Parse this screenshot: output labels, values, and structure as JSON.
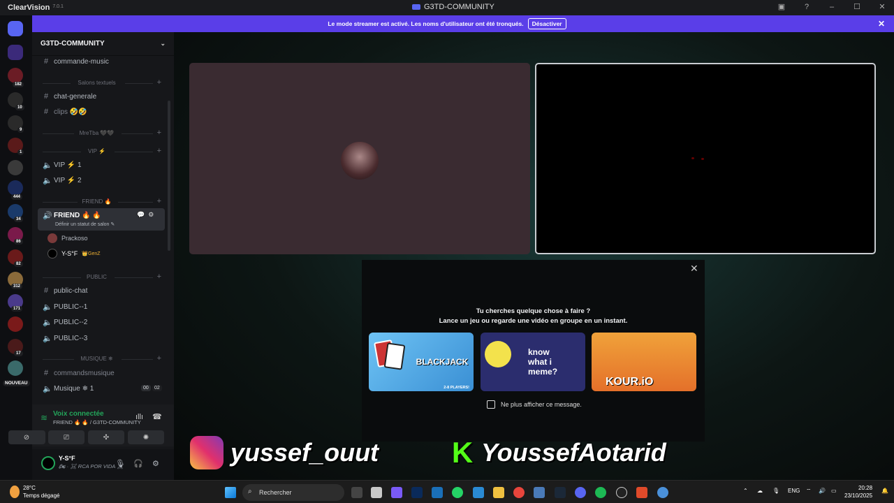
{
  "titlebar": {
    "app_name": "ClearVision",
    "app_version": "7.0.1",
    "window_title": "G3TD-COMMUNITY"
  },
  "banner": {
    "text": "Le mode streamer est activé. Les noms d'utilisateur ont été tronqués.",
    "button": "Désactiver",
    "close": "✕"
  },
  "guild_badges": [
    "182",
    "10",
    "9",
    "1",
    "444",
    "34",
    "86",
    "82",
    "312",
    "171",
    "17"
  ],
  "guild_new": "NOUVEAU",
  "sidebar": {
    "server_name": "G3TD-COMMUNITY",
    "channels": {
      "commande_music": "commande-music",
      "cat_textuels": "Salons textuels",
      "chat_generale": "chat-generale",
      "clips": "clips 🤣🤣",
      "cat_mretba": "MreTba 🖤🖤",
      "cat_vip": "VIP ⚡",
      "vip1": "VIP ⚡ 1",
      "vip2": "VIP ⚡ 2",
      "cat_friend": "FRIEND 🔥",
      "friend": "FRIEND 🔥 🔥",
      "friend_status": "Définir un statut de salon ✎",
      "user1": "Prackoso",
      "user2": "Y-S°F",
      "user2_tag": "👑GenZ",
      "cat_public": "PUBLIC",
      "public_chat": "public-chat",
      "public1": "PUBLIC--1",
      "public2": "PUBLIC--2",
      "public3": "PUBLIC--3",
      "cat_musique": "MUSIQUE ❄",
      "commandsmusique": "commandsmusique",
      "musique1": "Musique ❄ 1",
      "musique_count_a": "00",
      "musique_count_b": "02"
    },
    "voice": {
      "connected": "Voix connectée",
      "location": "FRIEND 🔥 🔥 / G3TD-COMMUNITY"
    },
    "user": {
      "name": "Y-S°F",
      "status": "🏍 · ☠ RCA POR VIDA ☠"
    }
  },
  "activity": {
    "line1": "Tu cherches quelque chose à faire ?",
    "line2": "Lance un jeu ou regarde une vidéo en groupe en un instant.",
    "card1": "BLACKJACK",
    "card1_sub": "2-8 PLAYERS!",
    "card2": "know what i meme?",
    "card3": "KOUR.iO",
    "checkbox": "Ne plus afficher ce message."
  },
  "overlay": {
    "instagram": "yussef_ouut",
    "kick": "YoussefAotarid"
  },
  "taskbar": {
    "temp": "28°C",
    "weather": "Temps dégagé",
    "search": "Rechercher",
    "lang": "ENG",
    "time": "20:28",
    "date": "23/10/2025"
  }
}
